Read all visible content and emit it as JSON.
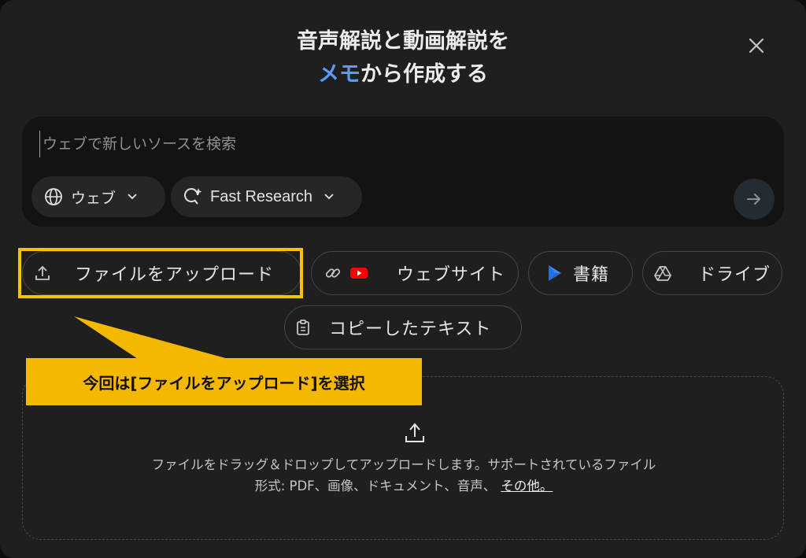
{
  "dialog": {
    "title_line1": "音声解説と動画解説を",
    "title_accent": "メモ",
    "title_line2_rest": "から作成する",
    "close_icon": "close-icon"
  },
  "search": {
    "placeholder": "ウェブで新しいソースを検索",
    "source_chip_label": "ウェブ",
    "mode_chip_label": "Fast Research",
    "submit_icon": "arrow-right-icon"
  },
  "sources": {
    "upload_label": "ファイルをアップロード",
    "website_label": "ウェブサイト",
    "books_label": "書籍",
    "drive_label": "ドライブ",
    "paste_label": "コピーしたテキスト"
  },
  "dropzone": {
    "line1": "ファイルをドラッグ＆ドロップしてアップロードします。サポートされているファイル",
    "line2": "形式: PDF、画像、ドキュメント、音声、",
    "more_link": "その他。"
  },
  "annotation": {
    "callout_text": "今回は[ファイルをアップロード]を選択",
    "color": "#f5b800"
  }
}
